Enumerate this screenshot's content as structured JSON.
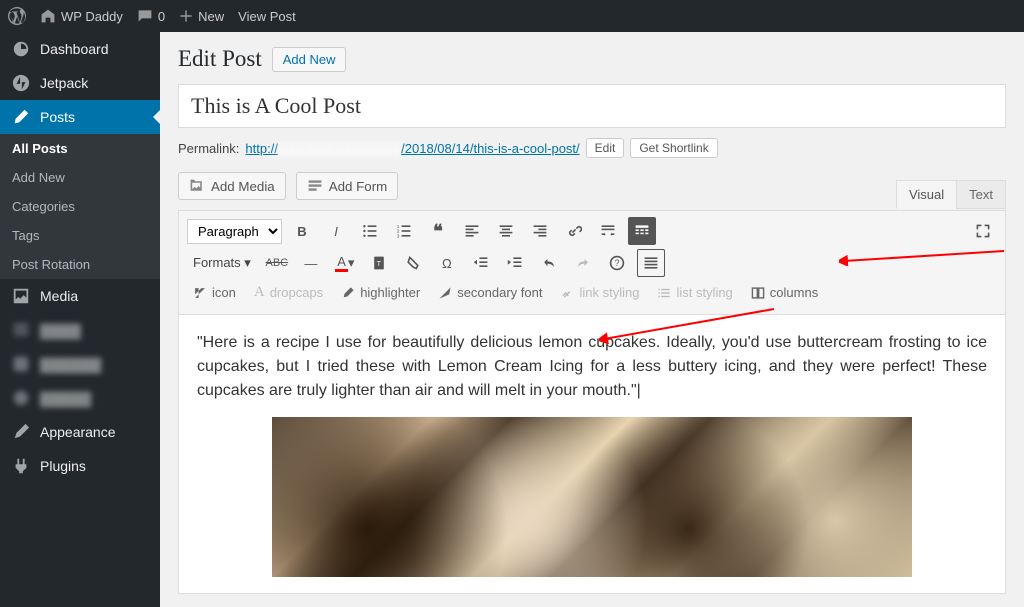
{
  "topbar": {
    "site": "WP Daddy",
    "comments": "0",
    "new": "New",
    "view": "View Post"
  },
  "sidebar": {
    "dashboard": "Dashboard",
    "jetpack": "Jetpack",
    "posts": "Posts",
    "media": "Media",
    "appearance": "Appearance",
    "plugins": "Plugins",
    "sub": {
      "all": "All Posts",
      "add": "Add New",
      "categories": "Categories",
      "tags": "Tags",
      "rotation": "Post Rotation"
    }
  },
  "page": {
    "title": "Edit Post",
    "addNew": "Add New"
  },
  "post": {
    "title": "This is A Cool Post"
  },
  "permalink": {
    "label": "Permalink:",
    "urlPrefix": "http://",
    "urlMid": "/2018/08/14/",
    "slug": "this-is-a-cool-post/",
    "edit": "Edit",
    "shortlink": "Get Shortlink"
  },
  "buttons": {
    "addMedia": "Add Media",
    "addForm": "Add Form"
  },
  "tabs": {
    "visual": "Visual",
    "text": "Text"
  },
  "toolbar": {
    "paragraph": "Paragraph",
    "formats": "Formats ▾",
    "ext": {
      "icon": "icon",
      "dropcaps": "dropcaps",
      "highlighter": "highlighter",
      "secondaryFont": "secondary font",
      "linkStyling": "link styling",
      "listStyling": "list styling",
      "columns": "columns"
    }
  },
  "editor": {
    "paragraph": "\"Here is a recipe I use for beautifully delicious lemon cupcakes. Ideally, you'd use buttercream frosting to ice cupcakes, but I tried these with Lemon Cream Icing for a less buttery icing, and they were perfect! These cupcakes are truly lighter than air and will melt in your mouth.\"|"
  }
}
